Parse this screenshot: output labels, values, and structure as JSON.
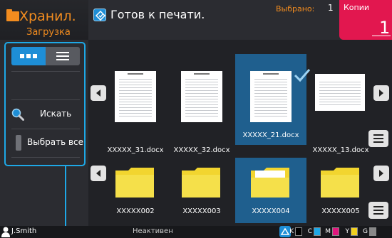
{
  "storage": {
    "title": "Хранил.",
    "subtitle": "Загрузка"
  },
  "sidebar": {
    "search_label": "Искать",
    "select_all_label": "Выбрать все"
  },
  "header": {
    "status": "Готов к печати.",
    "selected_label": "Выбрано:",
    "selected_count": "1",
    "copies_label": "Копии",
    "copies_value": "1"
  },
  "files": [
    {
      "name": "XXXXX_31.docx",
      "selected": false
    },
    {
      "name": "XXXXX_32.docx",
      "selected": false
    },
    {
      "name": "XXXXX_21.docx",
      "selected": true
    },
    {
      "name": "XXXXX_13.docx",
      "selected": false
    }
  ],
  "folders": [
    {
      "name": "XXXXX002",
      "selected": false
    },
    {
      "name": "XXXXX003",
      "selected": false
    },
    {
      "name": "XXXXX004",
      "selected": true
    },
    {
      "name": "XXXXX005",
      "selected": false
    }
  ],
  "footer": {
    "user": "J.Smith",
    "status": "Неактивен",
    "inks": [
      {
        "label": "K",
        "color": "#000000"
      },
      {
        "label": "C",
        "color": "#1ea8e6"
      },
      {
        "label": "M",
        "color": "#e2177e"
      },
      {
        "label": "Y",
        "color": "#f2d01f"
      },
      {
        "label": "G",
        "color": "#888888"
      }
    ]
  },
  "colors": {
    "accent": "#f28c1f",
    "selection": "#1f5f8e",
    "copies": "#e2174f",
    "highlight": "#1ea8e6"
  }
}
